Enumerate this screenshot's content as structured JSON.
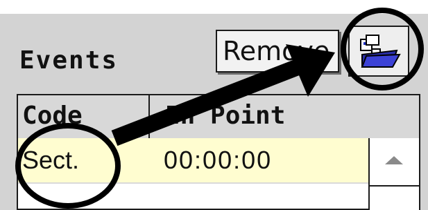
{
  "panel": {
    "title": "Events",
    "remove_label": "Remove",
    "folder_icon": "open-folder-icon"
  },
  "table": {
    "columns": [
      "Code",
      "In Point"
    ],
    "rows": [
      {
        "code": "Sect.",
        "in_point": "00:00:00"
      }
    ],
    "row_highlight_color": "#fffdd0"
  },
  "scrollbar": {
    "up_icon": "scroll-up-arrow-icon"
  },
  "annotations": {
    "circles": [
      "folder-button-highlight",
      "code-cell-highlight"
    ],
    "arrow": "arrow-to-folder-button",
    "color": "#000000"
  }
}
